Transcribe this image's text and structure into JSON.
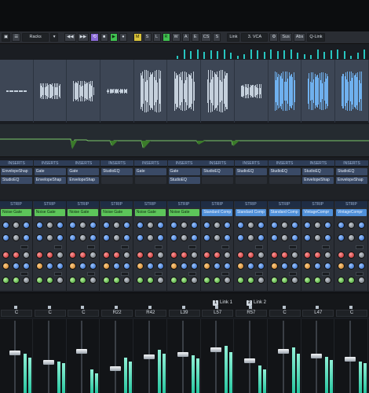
{
  "toolbar": {
    "racks_label": "Racks",
    "transport_m": "M",
    "transport_s": "S",
    "transport_l": "L",
    "transport_r": "R",
    "transport_w": "W",
    "transport_a": "A",
    "edit_e": "E",
    "edit_cs": "CS",
    "edit_s": "S",
    "link_label": "Link",
    "vca_label": "3. VCA",
    "sus_label": "Sus",
    "abs_label": "Abs",
    "qlink_label": "Q-Link"
  },
  "inserts": {
    "header": "INSERTS",
    "columns": [
      {
        "slots": [
          "EnvelopeShap",
          "StudioEQ"
        ]
      },
      {
        "slots": [
          "Gate",
          "EnvelopeShap"
        ]
      },
      {
        "slots": [
          "Gate",
          "EnvelopeShap"
        ]
      },
      {
        "slots": [
          "StudioEQ",
          ""
        ]
      },
      {
        "slots": [
          "Gate",
          ""
        ]
      },
      {
        "slots": [
          "Gate",
          "StudioEQ"
        ]
      },
      {
        "slots": [
          "StudioEQ",
          ""
        ]
      },
      {
        "slots": [
          "StudioEQ",
          ""
        ]
      },
      {
        "slots": [
          "StudioEQ",
          ""
        ]
      },
      {
        "slots": [
          "StudioEQ",
          "EnvelopeShap"
        ]
      },
      {
        "slots": [
          "StudioEQ",
          "EnvelopeShap"
        ]
      }
    ]
  },
  "strip": {
    "header": "STRIP",
    "modules": [
      "Noise Gate",
      "Noise Gate",
      "Noise Gate",
      "Noise Gate",
      "Noise Gate",
      "Noise Gate",
      "Standard Comp",
      "Standard Comp",
      "Standard Comp",
      "VintageCompr",
      "VintageCompr"
    ]
  },
  "links": {
    "link1": "Link 1",
    "link2": "Link 2",
    "link1_num": "1",
    "link2_num": "2"
  },
  "pans": [
    "C",
    "C",
    "C",
    "R22",
    "R42",
    "L39",
    "L57",
    "R57",
    "C",
    "L47",
    "C"
  ],
  "colors": {
    "accent_blue": "#4f8fd8",
    "accent_green": "#5dc55a",
    "meter_cyan": "#27c6c0",
    "wave_grey": "#c5d0dc",
    "wave_blue": "#6fb0ee"
  },
  "icons": {
    "racks": "grid-icon",
    "cycle": "loop-icon",
    "settings": "gear-icon"
  }
}
